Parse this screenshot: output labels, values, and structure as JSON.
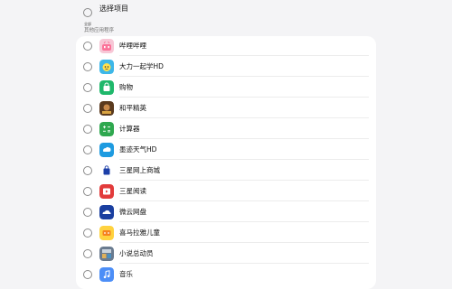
{
  "select_all": {
    "label": "选择项目",
    "all_text": "全部"
  },
  "section": {
    "header": "其他应用程序"
  },
  "apps": [
    {
      "label": "哔哩哔哩",
      "icon": "bilibili-icon"
    },
    {
      "label": "大力一起学HD",
      "icon": "dali-icon"
    },
    {
      "label": "购物",
      "icon": "shopping-bag-icon"
    },
    {
      "label": "和平精英",
      "icon": "game-peace-elite-icon"
    },
    {
      "label": "计算器",
      "icon": "calculator-icon"
    },
    {
      "label": "墨迹天气HD",
      "icon": "weather-icon"
    },
    {
      "label": "三星网上商城",
      "icon": "samsung-shop-icon"
    },
    {
      "label": "三星阅读",
      "icon": "samsung-reader-icon"
    },
    {
      "label": "微云网盘",
      "icon": "weiyun-cloud-icon"
    },
    {
      "label": "喜马拉雅儿童",
      "icon": "ximalaya-kids-icon"
    },
    {
      "label": "小说总动员",
      "icon": "novel-icon"
    },
    {
      "label": "音乐",
      "icon": "music-note-icon"
    }
  ]
}
